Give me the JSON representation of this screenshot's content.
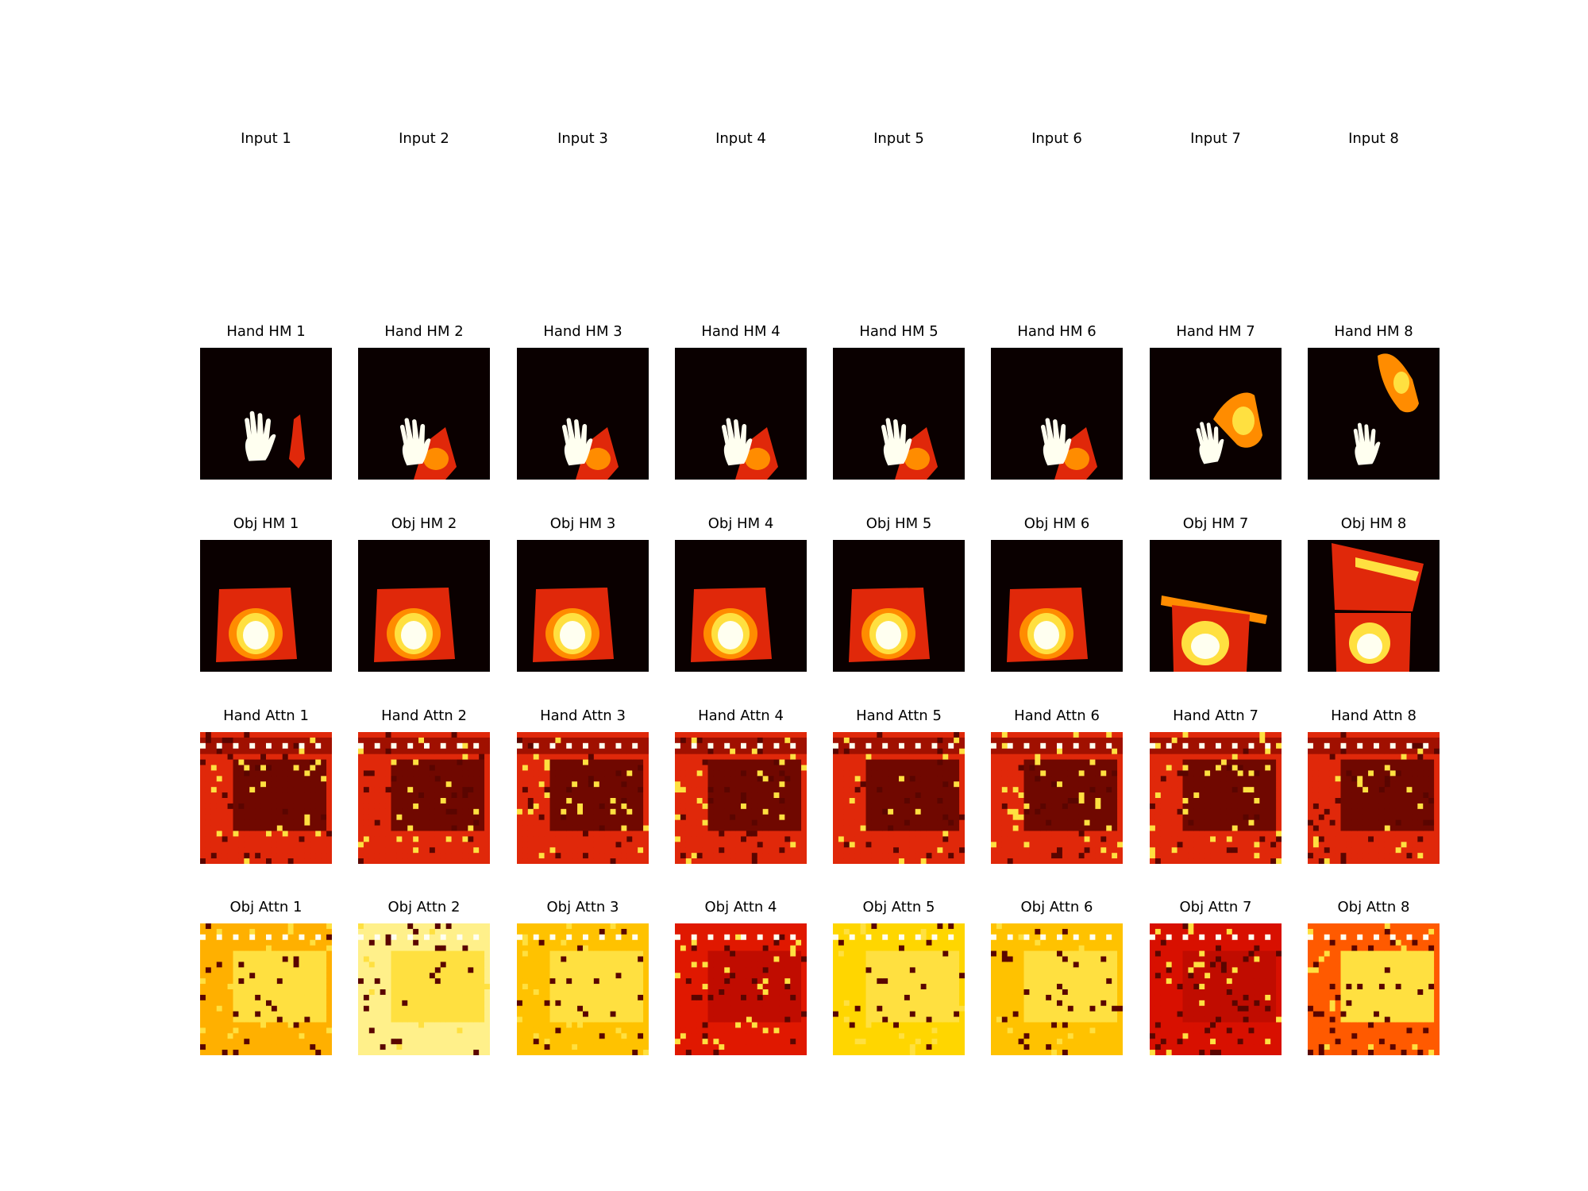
{
  "figure": {
    "rows": [
      {
        "key": "input",
        "kind": "blank",
        "titles": [
          "Input 1",
          "Input 2",
          "Input 3",
          "Input 4",
          "Input 5",
          "Input 6",
          "Input 7",
          "Input 8"
        ]
      },
      {
        "key": "hand_hm",
        "kind": "hand-heatmap",
        "titles": [
          "Hand HM 1",
          "Hand HM 2",
          "Hand HM 3",
          "Hand HM 4",
          "Hand HM 5",
          "Hand HM 6",
          "Hand HM 7",
          "Hand HM 8"
        ]
      },
      {
        "key": "obj_hm",
        "kind": "object-heatmap",
        "titles": [
          "Obj HM 1",
          "Obj HM 2",
          "Obj HM 3",
          "Obj HM 4",
          "Obj HM 5",
          "Obj HM 6",
          "Obj HM 7",
          "Obj HM 8"
        ]
      },
      {
        "key": "hand_attn",
        "kind": "hand-attention-map",
        "titles": [
          "Hand Attn 1",
          "Hand Attn 2",
          "Hand Attn 3",
          "Hand Attn 4",
          "Hand Attn 5",
          "Hand Attn 6",
          "Hand Attn 7",
          "Hand Attn 8"
        ]
      },
      {
        "key": "obj_attn",
        "kind": "object-attention-map",
        "titles": [
          "Obj Attn 1",
          "Obj Attn 2",
          "Obj Attn 3",
          "Obj Attn 4",
          "Obj Attn 5",
          "Obj Attn 6",
          "Obj Attn 7",
          "Obj Attn 8"
        ]
      }
    ],
    "colormap": {
      "background": "#0a0000",
      "dark": "#5a0500",
      "mid": "#e0280a",
      "bright": "#ff8c00",
      "hot": "#ffe040",
      "white": "#fffff0"
    },
    "obj_attn_backgrounds": [
      "#ffb000",
      "#fff08a",
      "#ffc200",
      "#e01800",
      "#ffd600",
      "#ffc200",
      "#d81000",
      "#ff5a00"
    ]
  }
}
